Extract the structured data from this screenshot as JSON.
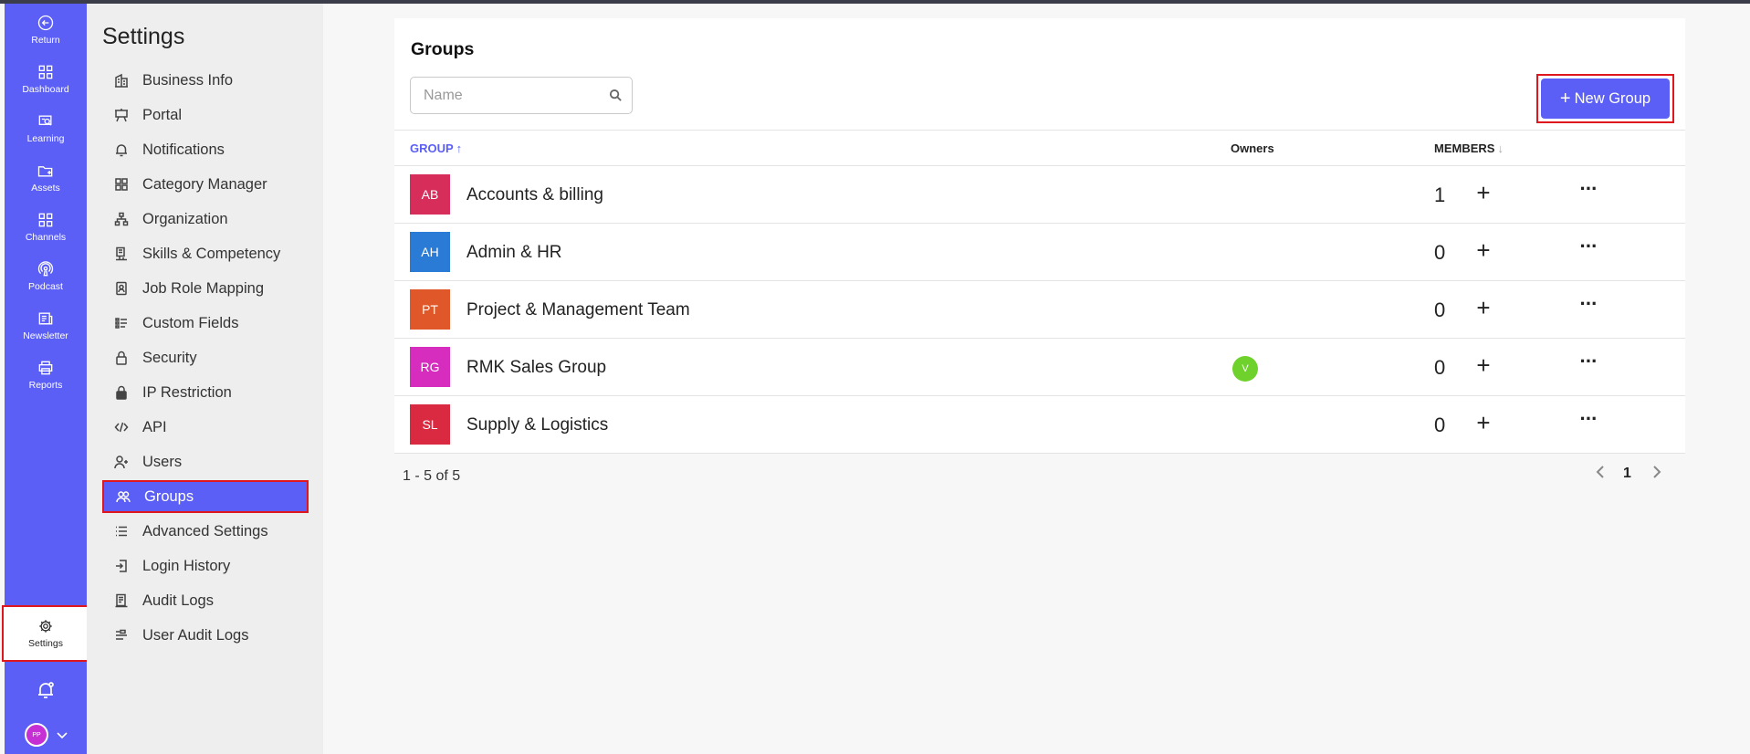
{
  "rail": {
    "items": [
      {
        "label": "Return",
        "icon": "return-icon"
      },
      {
        "label": "Dashboard",
        "icon": "dashboard-icon"
      },
      {
        "label": "Learning",
        "icon": "learning-icon"
      },
      {
        "label": "Assets",
        "icon": "assets-icon"
      },
      {
        "label": "Channels",
        "icon": "channels-icon"
      },
      {
        "label": "Podcast",
        "icon": "podcast-icon"
      },
      {
        "label": "Newsletter",
        "icon": "newsletter-icon"
      },
      {
        "label": "Reports",
        "icon": "reports-icon"
      }
    ],
    "settings_label": "Settings",
    "avatar_initials": "PP"
  },
  "sidebar": {
    "title": "Settings",
    "items": [
      {
        "label": "Business Info",
        "icon": "building-icon"
      },
      {
        "label": "Portal",
        "icon": "portal-icon"
      },
      {
        "label": "Notifications",
        "icon": "bell-icon"
      },
      {
        "label": "Category Manager",
        "icon": "grid-icon"
      },
      {
        "label": "Organization",
        "icon": "org-chart-icon"
      },
      {
        "label": "Skills & Competency",
        "icon": "skills-icon"
      },
      {
        "label": "Job Role Mapping",
        "icon": "id-badge-icon"
      },
      {
        "label": "Custom Fields",
        "icon": "fields-icon"
      },
      {
        "label": "Security",
        "icon": "lock-open-icon"
      },
      {
        "label": "IP Restriction",
        "icon": "lock-icon"
      },
      {
        "label": "API",
        "icon": "code-icon"
      },
      {
        "label": "Users",
        "icon": "user-plus-icon"
      },
      {
        "label": "Groups",
        "icon": "users-icon"
      },
      {
        "label": "Advanced Settings",
        "icon": "list-icon"
      },
      {
        "label": "Login History",
        "icon": "login-icon"
      },
      {
        "label": "Audit Logs",
        "icon": "audit-icon"
      },
      {
        "label": "User Audit Logs",
        "icon": "user-audit-icon"
      }
    ],
    "active": "Groups"
  },
  "main": {
    "title": "Groups",
    "search_placeholder": "Name",
    "new_button_label": "New Group",
    "columns": {
      "group": "GROUP",
      "owners": "Owners",
      "members": "MEMBERS"
    },
    "rows": [
      {
        "initials": "AB",
        "name": "Accounts & billing",
        "color": "#d62d5a",
        "owner": "",
        "members": "1"
      },
      {
        "initials": "AH",
        "name": "Admin & HR",
        "color": "#2a7bd6",
        "owner": "",
        "members": "0"
      },
      {
        "initials": "PT",
        "name": "Project & Management Team",
        "color": "#e0582a",
        "owner": "",
        "members": "0"
      },
      {
        "initials": "RG",
        "name": "RMK Sales Group",
        "color": "#d62dbf",
        "owner": "V",
        "members": "0"
      },
      {
        "initials": "SL",
        "name": "Supply & Logistics",
        "color": "#d92a42",
        "owner": "",
        "members": "0"
      }
    ],
    "pagination": {
      "info": "1 - 5 of 5",
      "current_page": "1"
    }
  },
  "colors": {
    "accent": "#5b5ff5",
    "highlight_border": "#e0161f",
    "owner_dot": "#6fd12c"
  }
}
